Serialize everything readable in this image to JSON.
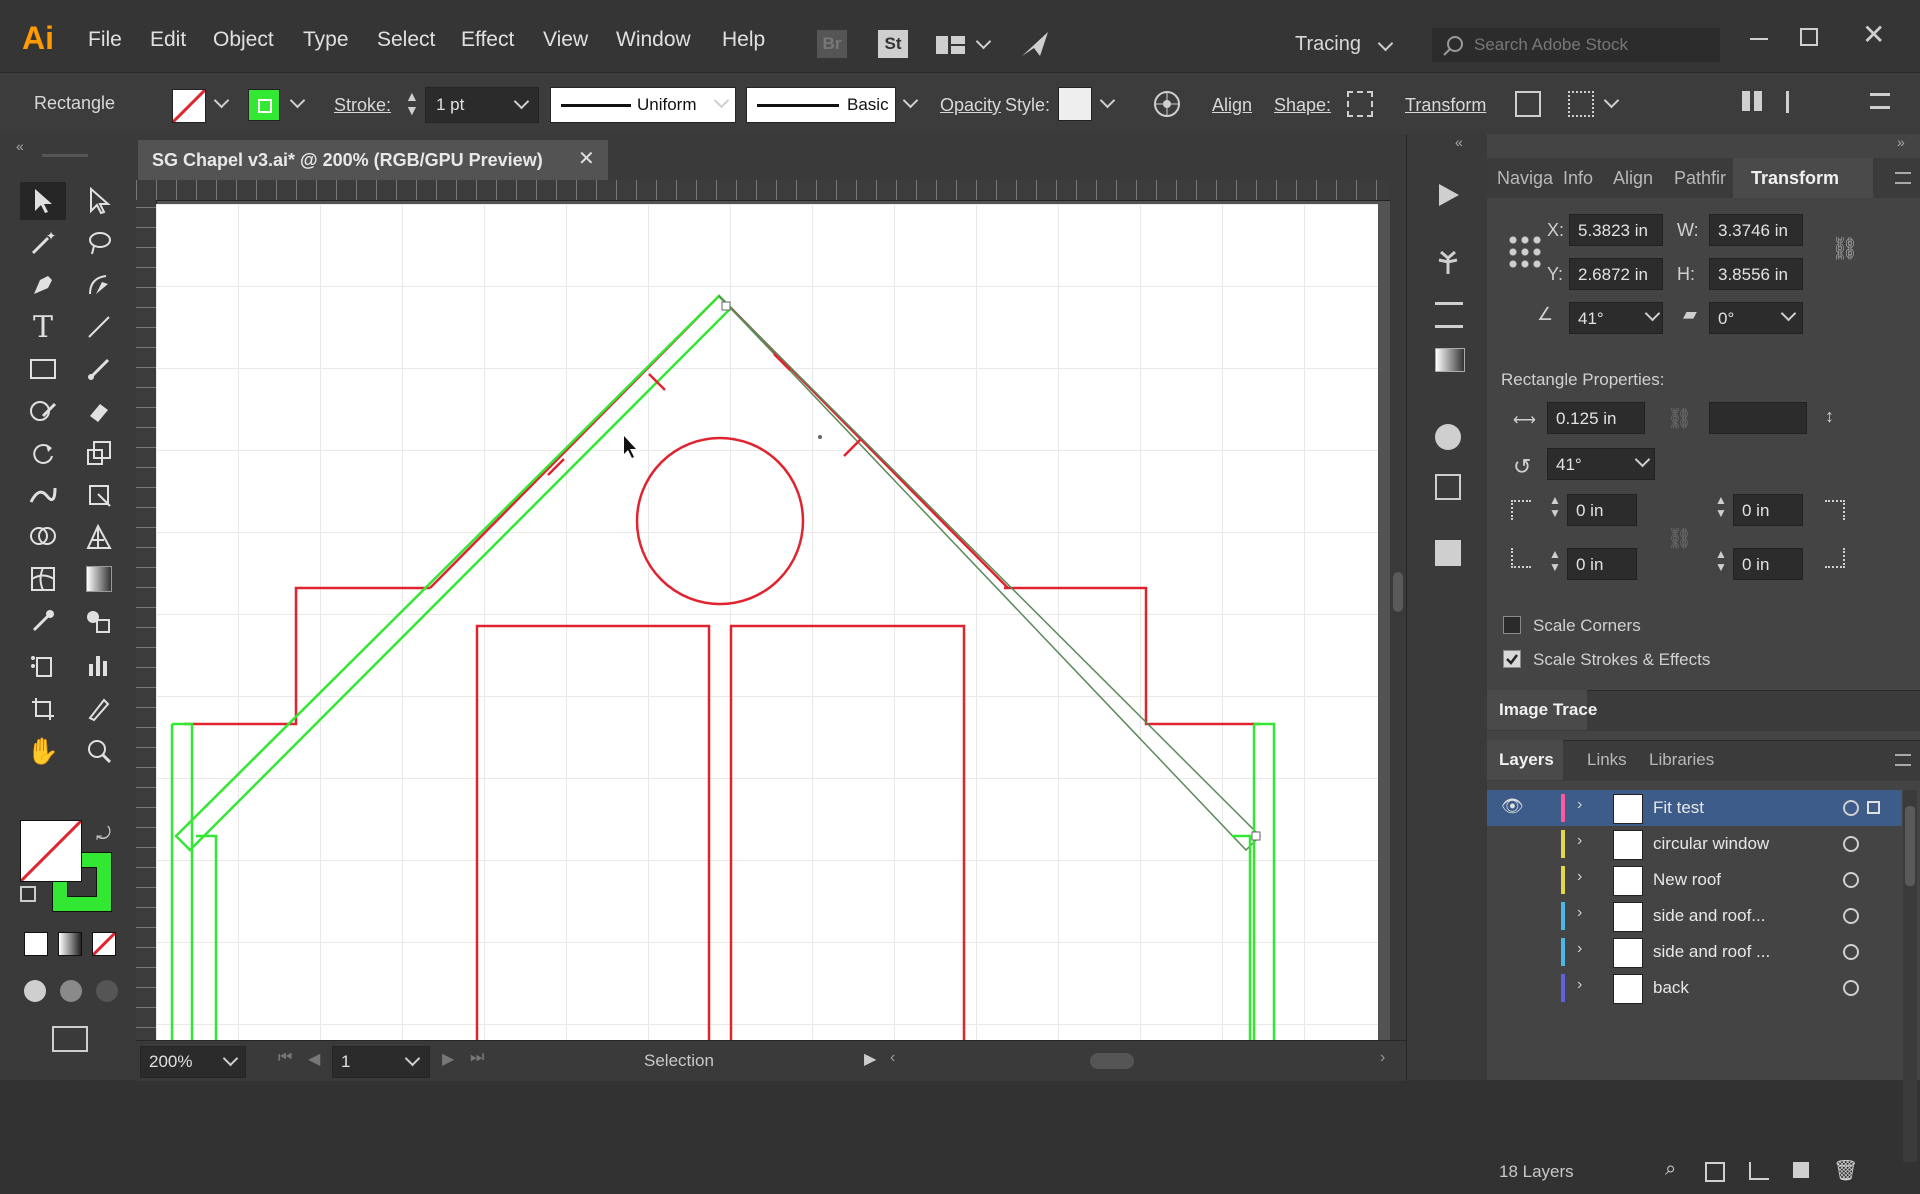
{
  "app": {
    "logo": "Ai",
    "menu": [
      "File",
      "Edit",
      "Object",
      "Type",
      "Select",
      "Effect",
      "View",
      "Window",
      "Help"
    ],
    "br": "Br",
    "st": "St",
    "workspace": "Tracing",
    "search_placeholder": "Search Adobe Stock"
  },
  "control": {
    "tool_name": "Rectangle",
    "stroke_label": "Stroke:",
    "stroke_value": "1 pt",
    "profile": "Uniform",
    "brush": "Basic",
    "opacity_label": "Opacity",
    "style_label": "Style:",
    "align": "Align",
    "shape": "Shape:",
    "transform": "Transform"
  },
  "document": {
    "tab_title": "SG Chapel v3.ai* @ 200% (RGB/GPU Preview)"
  },
  "status": {
    "zoom": "200%",
    "artboard": "1",
    "tool": "Selection"
  },
  "panel_tabs": [
    "Naviga",
    "Info",
    "Align",
    "Pathfir",
    "Transform"
  ],
  "transform": {
    "x_label": "X:",
    "x": "5.3823 in",
    "w_label": "W:",
    "w": "3.3746 in",
    "y_label": "Y:",
    "y": "2.6872 in",
    "h_label": "H:",
    "h": "3.8556 in",
    "angle": "41°",
    "shear": "0°",
    "rect_props": "Rectangle Properties:",
    "rect_width": "0.125 in",
    "rect_angle": "41°",
    "corner_tl": "0 in",
    "corner_tr": "0 in",
    "corner_bl": "0 in",
    "corner_br": "0 in",
    "scale_corners": "Scale Corners",
    "scale_strokes": "Scale Strokes & Effects"
  },
  "image_trace": "Image Trace",
  "layers_tabs": [
    "Layers",
    "Links",
    "Libraries"
  ],
  "layers": [
    {
      "name": "Fit test",
      "color": "#ff5aa0"
    },
    {
      "name": "circular window",
      "color": "#e0d84a"
    },
    {
      "name": "New roof",
      "color": "#e0d84a"
    },
    {
      "name": "side and roof...",
      "color": "#4fb6e6"
    },
    {
      "name": "side and roof ...",
      "color": "#4fb6e6"
    },
    {
      "name": "back",
      "color": "#6060e0"
    }
  ],
  "layers_count": "18 Layers",
  "colors": {
    "red": "#e0242f",
    "green": "#33e833",
    "accent": "#2f6fd0"
  }
}
